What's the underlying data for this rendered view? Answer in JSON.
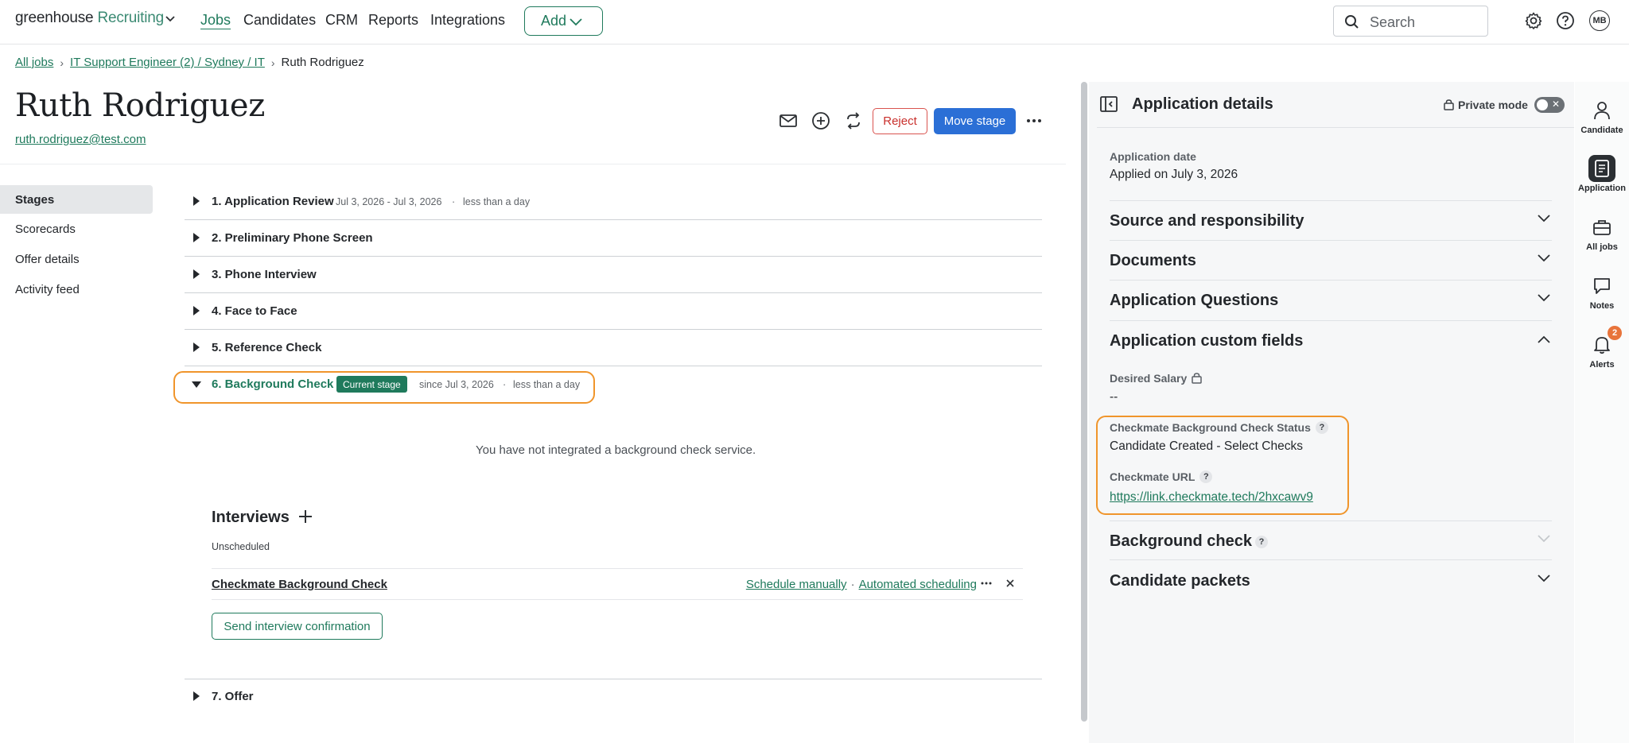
{
  "topnav": {
    "brand_main": "greenhouse",
    "brand_sub": "Recruiting",
    "links": [
      "Jobs",
      "Candidates",
      "CRM",
      "Reports",
      "Integrations"
    ],
    "add_label": "Add",
    "search_placeholder": "Search",
    "avatar_initials": "MB"
  },
  "breadcrumb": {
    "all_jobs": "All jobs",
    "job": "IT Support Engineer (2) / Sydney / IT",
    "current": "Ruth Rodriguez"
  },
  "candidate": {
    "name": "Ruth Rodriguez",
    "email": "ruth.rodriguez@test.com"
  },
  "actions": {
    "reject": "Reject",
    "move_stage": "Move stage"
  },
  "sidenav": [
    "Stages",
    "Scorecards",
    "Offer details",
    "Activity feed"
  ],
  "stages": [
    {
      "name": "1. Application Review",
      "dates": "Jul 3, 2026 - Jul 3, 2026",
      "duration": "less than a day"
    },
    {
      "name": "2. Preliminary Phone Screen"
    },
    {
      "name": "3. Phone Interview"
    },
    {
      "name": "4. Face to Face"
    },
    {
      "name": "5. Reference Check"
    },
    {
      "name": "6. Background Check",
      "badge": "Current stage",
      "since": "since Jul 3, 2026",
      "duration": "less than a day"
    },
    {
      "name": "7. Offer"
    }
  ],
  "background": {
    "notice": "You have not integrated a background check service."
  },
  "interviews": {
    "title": "Interviews",
    "unscheduled": "Unscheduled",
    "item_name": "Checkmate Background Check",
    "schedule_manually": "Schedule manually",
    "automated_scheduling": "Automated scheduling",
    "send_confirmation": "Send interview confirmation"
  },
  "panel": {
    "title": "Application details",
    "private_mode": "Private mode",
    "application_date_label": "Application date",
    "application_date_value": "Applied on July 3, 2026",
    "sections": {
      "source": "Source and responsibility",
      "documents": "Documents",
      "questions": "Application Questions",
      "custom_fields": "Application custom fields",
      "background_check": "Background check",
      "packets": "Candidate packets"
    },
    "desired_salary_label": "Desired Salary",
    "desired_salary_value": "--",
    "checkmate_status_label": "Checkmate Background Check Status",
    "checkmate_status_value": "Candidate Created - Select Checks",
    "checkmate_url_label": "Checkmate URL",
    "checkmate_url_value": "https://link.checkmate.tech/2hxcawv9"
  },
  "rail": {
    "candidate": "Candidate",
    "application": "Application",
    "all_jobs": "All jobs",
    "notes": "Notes",
    "alerts": "Alerts",
    "alerts_count": "2"
  },
  "colors": {
    "brand_green": "#1f7a5c",
    "primary_blue": "#2b6fd6",
    "reject_red": "#c9302c",
    "highlight_orange": "#f0952b"
  }
}
